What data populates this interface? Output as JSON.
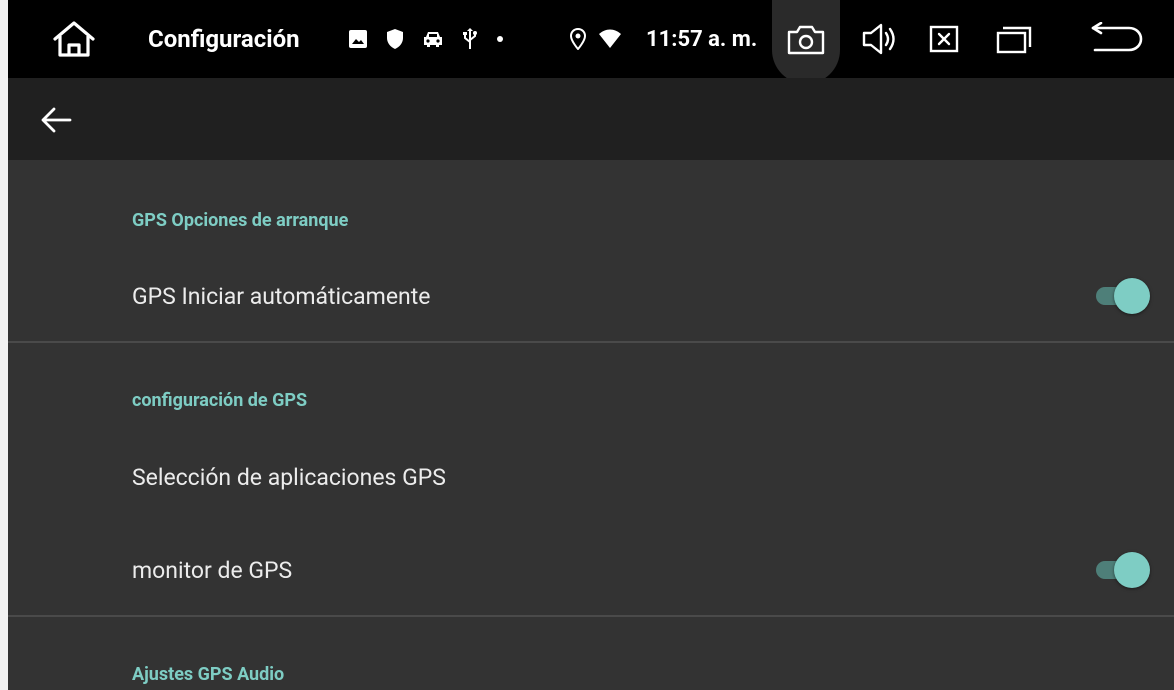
{
  "status_bar": {
    "app_title": "Configuración",
    "clock": "11:57 a. m.",
    "notification_icons": [
      "image-icon",
      "shield-icon",
      "car-icon",
      "usb-icon",
      "dot-icon"
    ],
    "system_icons": [
      "location-icon",
      "wifi-icon"
    ],
    "nav_icons": [
      "home-icon",
      "camera-icon",
      "volume-icon",
      "close-box-icon",
      "recents-icon",
      "return-icon"
    ]
  },
  "app_bar": {
    "back_icon": "arrow-left-icon"
  },
  "settings": {
    "sections": [
      {
        "header": "GPS Opciones de arranque",
        "items": [
          {
            "title": "GPS Iniciar automáticamente",
            "toggle": true,
            "checked": true
          }
        ]
      },
      {
        "header": "configuración de GPS",
        "items": [
          {
            "title": "Selección de aplicaciones GPS",
            "toggle": false
          },
          {
            "title": "monitor de GPS",
            "toggle": true,
            "checked": true
          }
        ]
      },
      {
        "header": "Ajustes GPS Audio",
        "items": []
      }
    ]
  },
  "colors": {
    "accent": "#7ecdc4",
    "accent_track": "#4e7f79",
    "background": "#333333",
    "app_bar": "#202020",
    "status_bar": "#000000"
  }
}
